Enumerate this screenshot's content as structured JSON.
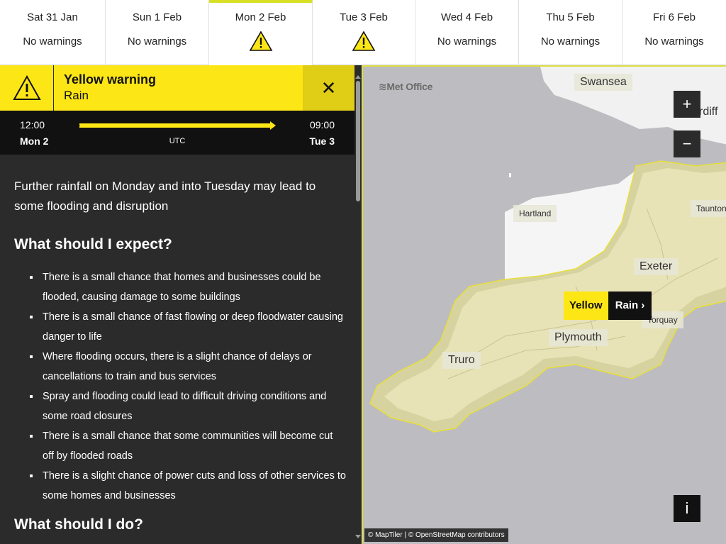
{
  "days": [
    {
      "name": "Sat 31 Jan",
      "status": "No warnings",
      "warning": false
    },
    {
      "name": "Sun 1 Feb",
      "status": "No warnings",
      "warning": false
    },
    {
      "name": "Mon 2 Feb",
      "status": "",
      "warning": true,
      "active": true
    },
    {
      "name": "Tue 3 Feb",
      "status": "",
      "warning": true
    },
    {
      "name": "Wed 4 Feb",
      "status": "No warnings",
      "warning": false
    },
    {
      "name": "Thu 5 Feb",
      "status": "No warnings",
      "warning": false
    },
    {
      "name": "Fri 6 Feb",
      "status": "No warnings",
      "warning": false
    }
  ],
  "warning": {
    "level": "Yellow warning",
    "type": "Rain",
    "close_label": "✕",
    "start_time": "12:00",
    "start_day": "Mon 2",
    "end_time": "09:00",
    "end_day": "Tue 3",
    "timezone": "UTC",
    "color": "#fde616"
  },
  "details": {
    "summary": "Further rainfall on Monday and into Tuesday may lead to some flooding and disruption",
    "expect_heading": "What should I expect?",
    "expect_items": [
      "There is a small chance that homes and businesses could be flooded, causing damage to some buildings",
      "There is a small chance of fast flowing or deep floodwater causing danger to life",
      "Where flooding occurs, there is a slight chance of delays or cancellations to train and bus services",
      "Spray and flooding could lead to difficult driving conditions and some road closures",
      "There is a small chance that some communities will become cut off by flooded roads",
      "There is a slight chance of power cuts and loss of other services to some homes and businesses"
    ],
    "do_heading": "What should I do?"
  },
  "map": {
    "brand": "≋Met Office",
    "places": {
      "swansea": "Swansea",
      "cardiff": "rdiff",
      "hartland": "Hartland",
      "taunton": "Taunton",
      "exeter": "Exeter",
      "torquay": "Torquay",
      "plymouth": "Plymouth",
      "truro": "Truro"
    },
    "zoom_in": "+",
    "zoom_out": "−",
    "info": "i",
    "attribution": "© MapTiler | © OpenStreetMap contributors",
    "label_level": "Yellow",
    "label_type": "Rain ›"
  }
}
